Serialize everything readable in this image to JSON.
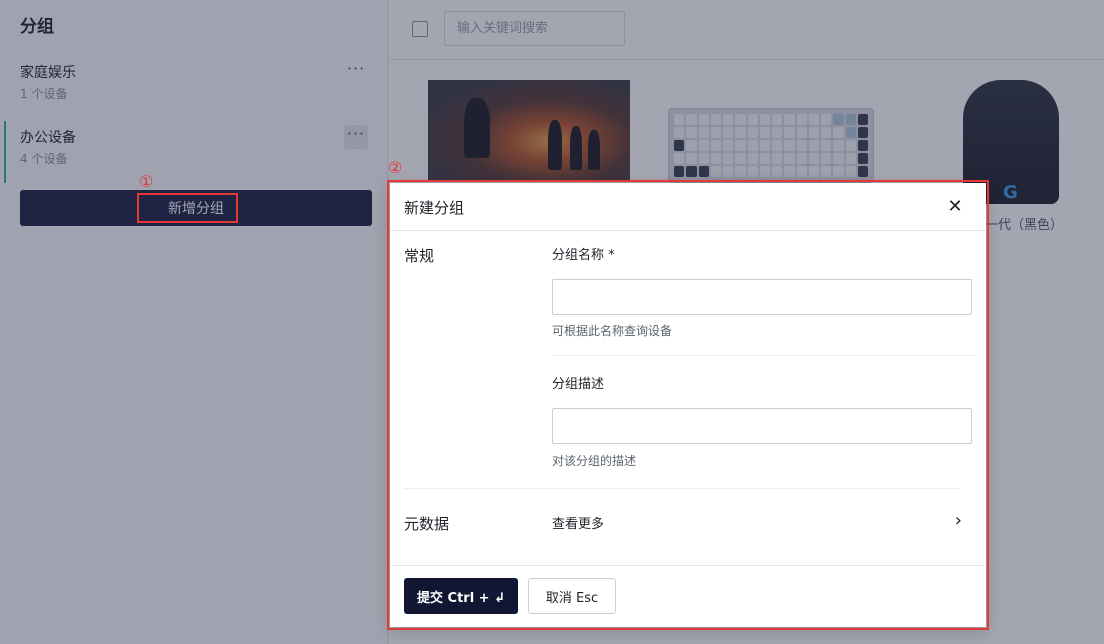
{
  "sidebar": {
    "title": "分组",
    "groups": [
      {
        "name": "家庭娱乐",
        "count": "1 个设备",
        "more": "···"
      },
      {
        "name": "办公设备",
        "count": "4 个设备",
        "more": "···"
      }
    ],
    "add_button": "新增分组"
  },
  "toolbar": {
    "search_placeholder": "输入关键词搜索"
  },
  "devices": {
    "partial_label": "一代（黑色）",
    "mouse_logo": "G"
  },
  "modal": {
    "title": "新建分组",
    "close_icon": "✕",
    "general_section": "常规",
    "name_label": "分组名称 *",
    "name_help": "可根据此名称查询设备",
    "desc_label": "分组描述",
    "desc_help": "对该分组的描述",
    "metadata_section": "元数据",
    "view_more": "查看更多",
    "chevron": "›",
    "submit": "提交 Ctrl + ↲",
    "cancel": "取消 Esc"
  },
  "annotations": {
    "marker_1": "①",
    "marker_2": "②",
    "color": "#e53935"
  }
}
